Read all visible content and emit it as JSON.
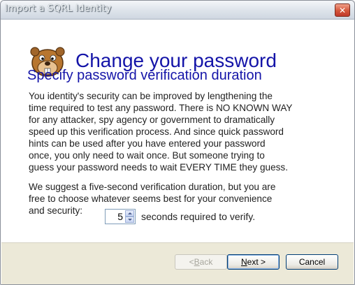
{
  "window": {
    "title": "Import a SQRL Identity"
  },
  "header": {
    "heading": "Change your password",
    "logo_icon": "beaver-mascot-icon"
  },
  "content": {
    "subheading": "Specify password verification duration",
    "paragraph1": [
      "You identity's security can be improved by lengthening the",
      "time required to test any password. There is NO KNOWN WAY",
      "for any attacker, spy agency or government to dramatically",
      "speed up this verification process. And since quick password",
      "hints can be used after you have entered your password",
      "once, you only need to wait once.  But someone trying to",
      "guess your password needs to wait EVERY TIME they guess."
    ],
    "paragraph2": [
      "We suggest a five-second verification duration, but you are",
      "free to choose whatever seems best for your convenience",
      "and security:"
    ],
    "duration": {
      "value": "5",
      "label": "seconds required to verify."
    }
  },
  "buttons": {
    "back": {
      "prefix": "< ",
      "mnemonic": "B",
      "rest": "ack"
    },
    "next": {
      "mnemonic": "N",
      "rest": "ext >"
    },
    "cancel": {
      "label": "Cancel"
    }
  },
  "colors": {
    "heading": "#1414a8",
    "footer": "#ece9d8",
    "close": "#c0392b"
  }
}
